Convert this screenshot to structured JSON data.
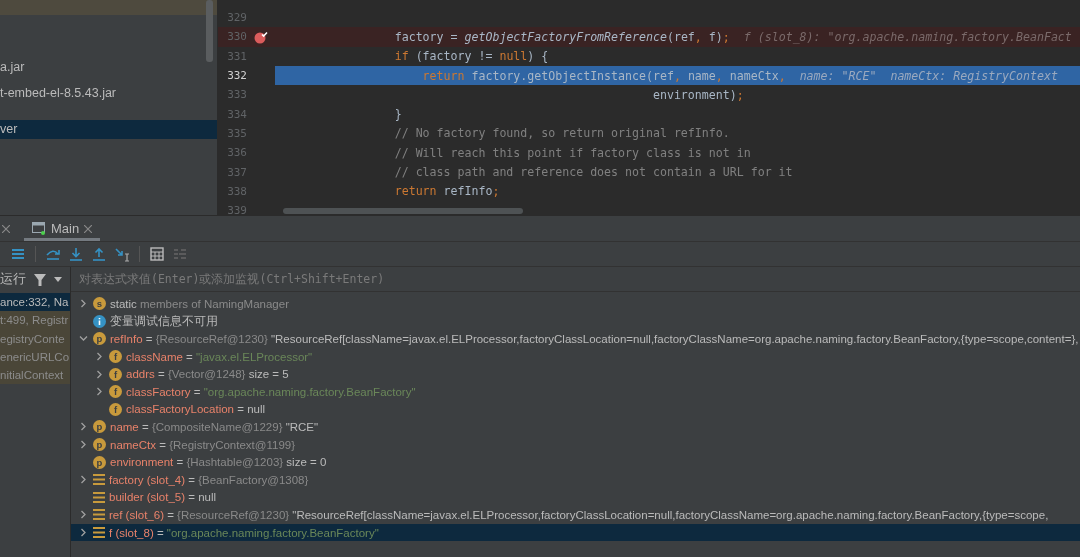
{
  "project_panel": {
    "items": [
      {
        "label": "a.jar",
        "selected": false
      },
      {
        "label": "t-embed-el-8.5.43.jar",
        "selected": false
      },
      {
        "label": "ver",
        "selected": true
      }
    ]
  },
  "editor": {
    "lines": [
      {
        "number": "329",
        "breakpoint": false,
        "current": false
      },
      {
        "number": "330",
        "breakpoint": true,
        "current": false,
        "code": [
          {
            "kind": "plain",
            "text": "                factory = "
          },
          {
            "kind": "static",
            "text": "getObjectFactoryFromReference"
          },
          {
            "kind": "plain",
            "text": "(ref"
          },
          {
            "kind": "kw",
            "text": ", "
          },
          {
            "kind": "plain",
            "text": "f)"
          },
          {
            "kind": "kw",
            "text": ";"
          }
        ],
        "hints": [
          "f (slot_8): \"org.apache.naming.factory.BeanFact"
        ]
      },
      {
        "number": "331",
        "breakpoint": false,
        "current": false,
        "code": [
          {
            "kind": "kw",
            "text": "                if"
          },
          {
            "kind": "plain",
            "text": " (factory != "
          },
          {
            "kind": "kw",
            "text": "null"
          },
          {
            "kind": "plain",
            "text": ") {"
          }
        ]
      },
      {
        "number": "332",
        "breakpoint": false,
        "current": true,
        "code": [
          {
            "kind": "kw",
            "text": "                    return"
          },
          {
            "kind": "plain",
            "text": " factory.getObjectInstance(ref"
          },
          {
            "kind": "kw",
            "text": ", "
          },
          {
            "kind": "plain",
            "text": "name"
          },
          {
            "kind": "kw",
            "text": ", "
          },
          {
            "kind": "plain",
            "text": "nameCtx"
          },
          {
            "kind": "kw",
            "text": ","
          }
        ],
        "hints": [
          "name: \"RCE\"",
          "nameCtx: RegistryContext"
        ]
      },
      {
        "number": "333",
        "breakpoint": false,
        "current": false,
        "code": [
          {
            "kind": "plain",
            "text": "                                                     environment)"
          },
          {
            "kind": "kw",
            "text": ";"
          }
        ]
      },
      {
        "number": "334",
        "breakpoint": false,
        "current": false,
        "code": [
          {
            "kind": "plain",
            "text": "                }"
          }
        ]
      },
      {
        "number": "335",
        "breakpoint": false,
        "current": false,
        "code": [
          {
            "kind": "comment",
            "text": "                // No factory found, so return original refInfo."
          }
        ]
      },
      {
        "number": "336",
        "breakpoint": false,
        "current": false,
        "code": [
          {
            "kind": "comment",
            "text": "                // Will reach this point if factory class is not in"
          }
        ]
      },
      {
        "number": "337",
        "breakpoint": false,
        "current": false,
        "code": [
          {
            "kind": "comment",
            "text": "                // class path and reference does not contain a URL for it"
          }
        ]
      },
      {
        "number": "338",
        "breakpoint": false,
        "current": false,
        "code": [
          {
            "kind": "kw",
            "text": "                return"
          },
          {
            "kind": "plain",
            "text": " refInfo"
          },
          {
            "kind": "kw",
            "text": ";"
          }
        ]
      },
      {
        "number": "339",
        "breakpoint": false,
        "current": false
      }
    ]
  },
  "debugger": {
    "tabs": [
      {
        "label": "Main",
        "selected": true
      }
    ],
    "frames_label": "运行",
    "frames": [
      {
        "label": "ance:332, Na",
        "selected": true,
        "library": false
      },
      {
        "label": "t:499, Registr",
        "selected": false,
        "library": true
      },
      {
        "label": "egistryConte",
        "selected": false,
        "library": true
      },
      {
        "label": "enericURLCo",
        "selected": false,
        "library": true
      },
      {
        "label": "nitialContext",
        "selected": false,
        "library": true
      }
    ],
    "evaluate": {
      "placeholder": "对表达式求值(Enter)或添加监视(Ctrl+Shift+Enter)"
    },
    "variables": [
      {
        "kind": "static",
        "badge": "s",
        "expandable": true,
        "expanded": false,
        "selected": false,
        "text": [
          {
            "kind": "plain",
            "text": "static"
          },
          {
            "kind": "ref",
            "text": " members of NamingManager"
          }
        ]
      },
      {
        "kind": "info",
        "expandable": false,
        "selected": false,
        "text": [
          {
            "kind": "plain",
            "text": "变量调试信息不可用"
          }
        ]
      },
      {
        "kind": "param",
        "badge": "p",
        "expandable": true,
        "expanded": true,
        "selected": false,
        "text": [
          {
            "kind": "name",
            "text": "refInfo"
          },
          {
            "kind": "plain",
            "text": " = "
          },
          {
            "kind": "ref",
            "text": "{ResourceRef@1230}"
          },
          {
            "kind": "plain",
            "text": " \"ResourceRef[className=javax.el.ELProcessor,factoryClassLocation=null,factoryClassName=org.apache.naming.factory.BeanFactory,{type=scope,content=},"
          }
        ],
        "children": [
          {
            "kind": "field",
            "badge": "f",
            "expandable": true,
            "expanded": false,
            "selected": false,
            "text": [
              {
                "kind": "name",
                "text": "className"
              },
              {
                "kind": "plain",
                "text": " = "
              },
              {
                "kind": "string",
                "text": "\"javax.el.ELProcessor\""
              }
            ]
          },
          {
            "kind": "field",
            "badge": "f",
            "expandable": true,
            "expanded": false,
            "selected": false,
            "text": [
              {
                "kind": "name",
                "text": "addrs"
              },
              {
                "kind": "plain",
                "text": " = "
              },
              {
                "kind": "ref",
                "text": "{Vector@1248}"
              },
              {
                "kind": "plain",
                "text": "  size = 5"
              }
            ]
          },
          {
            "kind": "field",
            "badge": "f",
            "expandable": true,
            "expanded": false,
            "selected": false,
            "text": [
              {
                "kind": "name",
                "text": "classFactory"
              },
              {
                "kind": "plain",
                "text": " = "
              },
              {
                "kind": "string",
                "text": "\"org.apache.naming.factory.BeanFactory\""
              }
            ]
          },
          {
            "kind": "field",
            "badge": "f",
            "expandable": false,
            "selected": false,
            "text": [
              {
                "kind": "name",
                "text": "classFactoryLocation"
              },
              {
                "kind": "plain",
                "text": " = null"
              }
            ]
          }
        ]
      },
      {
        "kind": "param",
        "badge": "p",
        "expandable": true,
        "expanded": false,
        "selected": false,
        "text": [
          {
            "kind": "name",
            "text": "name"
          },
          {
            "kind": "plain",
            "text": " = "
          },
          {
            "kind": "ref",
            "text": "{CompositeName@1229}"
          },
          {
            "kind": "plain",
            "text": " \"RCE\""
          }
        ]
      },
      {
        "kind": "param",
        "badge": "p",
        "expandable": true,
        "expanded": false,
        "selected": false,
        "text": [
          {
            "kind": "name",
            "text": "nameCtx"
          },
          {
            "kind": "plain",
            "text": " = "
          },
          {
            "kind": "ref",
            "text": "{RegistryContext@1199}"
          }
        ]
      },
      {
        "kind": "param",
        "badge": "p",
        "expandable": false,
        "selected": false,
        "text": [
          {
            "kind": "name",
            "text": "environment"
          },
          {
            "kind": "plain",
            "text": " = "
          },
          {
            "kind": "ref",
            "text": "{Hashtable@1203}"
          },
          {
            "kind": "plain",
            "text": "  size = 0"
          }
        ]
      },
      {
        "kind": "local",
        "expandable": true,
        "expanded": false,
        "selected": false,
        "text": [
          {
            "kind": "name",
            "text": "factory (slot_4)"
          },
          {
            "kind": "plain",
            "text": " = "
          },
          {
            "kind": "ref",
            "text": "{BeanFactory@1308}"
          }
        ]
      },
      {
        "kind": "local",
        "expandable": false,
        "selected": false,
        "text": [
          {
            "kind": "name",
            "text": "builder (slot_5)"
          },
          {
            "kind": "plain",
            "text": " = null"
          }
        ]
      },
      {
        "kind": "local",
        "expandable": true,
        "expanded": false,
        "selected": false,
        "text": [
          {
            "kind": "name",
            "text": "ref (slot_6)"
          },
          {
            "kind": "plain",
            "text": " = "
          },
          {
            "kind": "ref",
            "text": "{ResourceRef@1230}"
          },
          {
            "kind": "plain",
            "text": " \"ResourceRef[className=javax.el.ELProcessor,factoryClassLocation=null,factoryClassName=org.apache.naming.factory.BeanFactory,{type=scope,"
          }
        ]
      },
      {
        "kind": "local",
        "expandable": true,
        "expanded": false,
        "selected": true,
        "text": [
          {
            "kind": "name",
            "text": "f (slot_8)"
          },
          {
            "kind": "plain",
            "text": " = "
          },
          {
            "kind": "string",
            "text": "\"org.apache.naming.factory.BeanFactory\""
          }
        ]
      }
    ]
  }
}
